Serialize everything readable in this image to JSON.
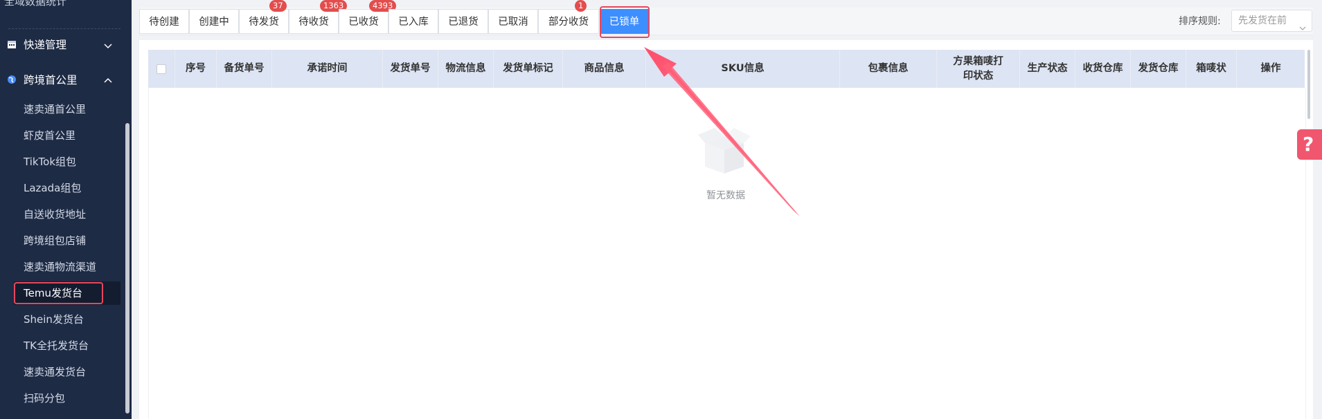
{
  "sidebar": {
    "top_cut_label": "全域数据统计",
    "groups": [
      {
        "label": "快递管理",
        "icon": "calendar-icon",
        "expanded": false
      },
      {
        "label": "跨境首公里",
        "icon": "globe-icon",
        "expanded": true
      }
    ],
    "items": [
      {
        "label": "速卖通首公里"
      },
      {
        "label": "虾皮首公里"
      },
      {
        "label": "TikTok组包"
      },
      {
        "label": "Lazada组包"
      },
      {
        "label": "自送收货地址"
      },
      {
        "label": "跨境组包店铺"
      },
      {
        "label": "速卖通物流渠道"
      },
      {
        "label": "Temu发货台",
        "active": true
      },
      {
        "label": "Shein发货台"
      },
      {
        "label": "TK全托发货台"
      },
      {
        "label": "速卖通发货台"
      },
      {
        "label": "扫码分包"
      }
    ]
  },
  "tabs": [
    {
      "label": "待创建"
    },
    {
      "label": "创建中"
    },
    {
      "label": "待发货",
      "badge": "37"
    },
    {
      "label": "待收货",
      "badge": "1363"
    },
    {
      "label": "已收货",
      "badge": "4393"
    },
    {
      "label": "已入库"
    },
    {
      "label": "已退货"
    },
    {
      "label": "已取消"
    },
    {
      "label": "部分收货",
      "badge": "1"
    },
    {
      "label": "已锁单",
      "active": true
    }
  ],
  "sort": {
    "label": "排序规则:",
    "value": "先发货在前"
  },
  "table": {
    "columns": [
      "序号",
      "备货单号",
      "承诺时间",
      "发货单号",
      "物流信息",
      "发货单标记",
      "商品信息",
      "SKU信息",
      "包裹信息",
      "方果箱唛打印状态",
      "生产状态",
      "收货仓库",
      "发货仓库",
      "箱唛状",
      "操作"
    ],
    "empty_text": "暂无数据"
  },
  "help": {
    "label": "?"
  },
  "colors": {
    "accent": "#3d8eff",
    "badge": "#e34d4d",
    "highlight": "#e8465d",
    "sidebar_bg": "#1e2b45"
  }
}
